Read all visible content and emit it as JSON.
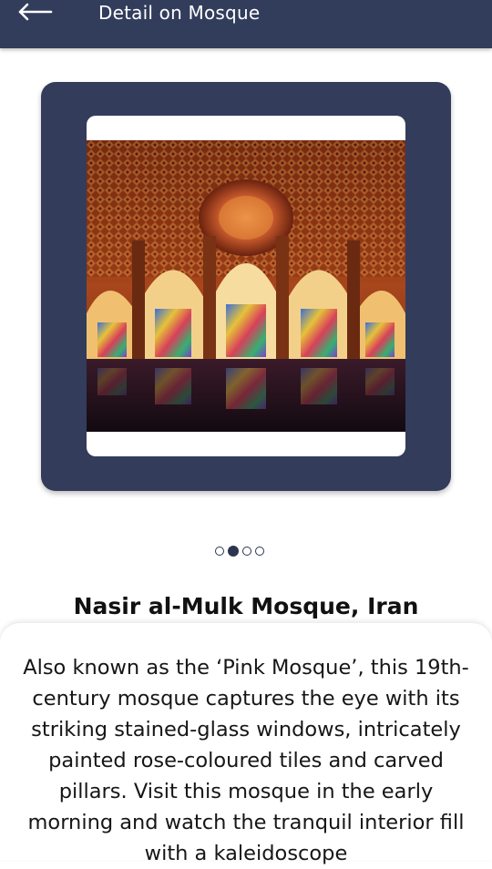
{
  "appbar": {
    "title": "Detail on Mosque",
    "back_icon": "arrow-left-icon"
  },
  "gallery": {
    "image_alt": "Interior of Nasir al-Mulk Mosque with stained-glass windows",
    "slides": 4,
    "active_index": 1
  },
  "place": {
    "title": "Nasir al-Mulk Mosque, Iran",
    "description": "Also known as the ‘Pink Mosque’, this 19th-century mosque captures the eye with its striking stained-glass windows, intricately painted rose-coloured tiles and carved pillars. Visit this mosque in the early morning and watch the tranquil interior fill with a kaleidoscope"
  },
  "colors": {
    "primary": "#323d5c",
    "card": "#333c5b",
    "text": "#161616"
  }
}
